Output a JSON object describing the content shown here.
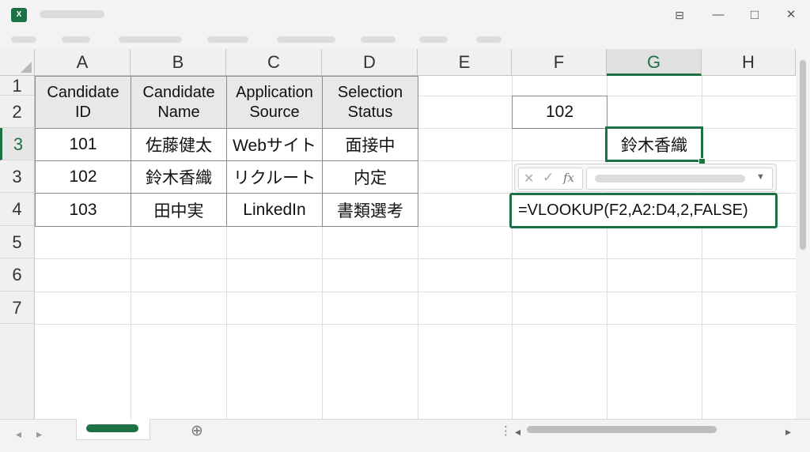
{
  "app": {
    "logo_letter": "X"
  },
  "window": {
    "restore_icon": "⊟",
    "minimize_icon": "—",
    "maximize_icon": "□",
    "close_icon": "✕"
  },
  "columns": [
    "A",
    "B",
    "C",
    "D",
    "E",
    "F",
    "G",
    "H"
  ],
  "rows": [
    "1",
    "2",
    "3",
    "3",
    "4",
    "5",
    "6",
    "7"
  ],
  "selected_column": "G",
  "selected_row": "3",
  "table": {
    "headers": [
      {
        "line1": "Candidate",
        "line2": "ID"
      },
      {
        "line1": "Candidate",
        "line2": "Name"
      },
      {
        "line1": "Application",
        "line2": "Source"
      },
      {
        "line1": "Selection",
        "line2": "Status"
      }
    ],
    "rows": [
      [
        "101",
        "佐藤健太",
        "Webサイト",
        "面接中"
      ],
      [
        "102",
        "鈴木香織",
        "リクルート",
        "内定"
      ],
      [
        "103",
        "田中実",
        "LinkedIn",
        "書類選考"
      ]
    ]
  },
  "lookup": {
    "input_value": "102",
    "result_value": "鈴木香織",
    "formula": "=VLOOKUP(F2,A2:D4,2,FALSE)"
  },
  "formula_bar": {
    "cancel_icon": "✕",
    "enter_icon": "✓",
    "fx_label": "fx",
    "dropdown_icon": "▼"
  },
  "bottom": {
    "add_sheet_icon": "⊕",
    "left_icon": "◂",
    "right_icon": "▸",
    "more_icon": "⋮"
  },
  "colors": {
    "accent": "#1e7145"
  }
}
